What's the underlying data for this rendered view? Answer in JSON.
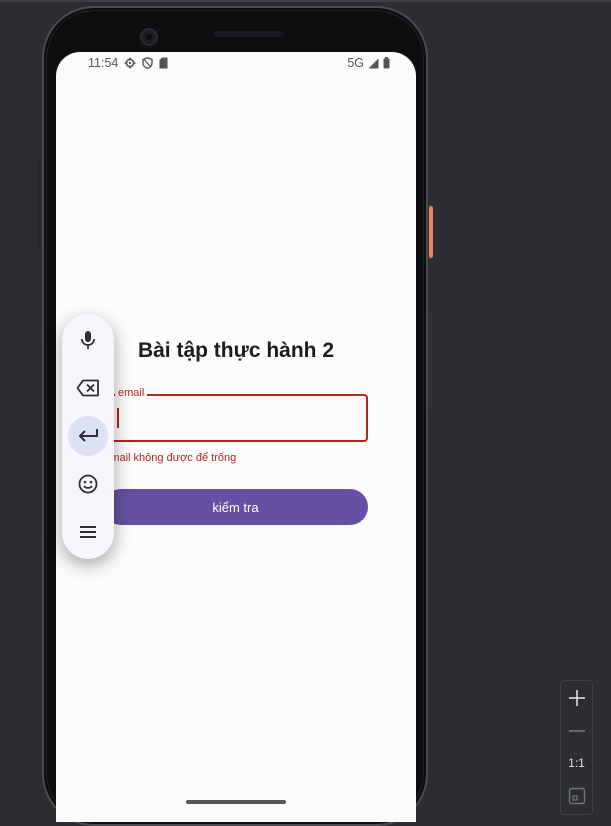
{
  "status_bar": {
    "time": "11:54",
    "network": "5G",
    "left_icons": [
      "gear-icon",
      "shield-icon",
      "sd-card-icon"
    ],
    "right_icons": [
      "signal-icon",
      "battery-icon"
    ]
  },
  "app": {
    "title": "Bài tập thực hành 2",
    "email_field": {
      "label": "email",
      "value": "",
      "error": "Email không được để trống"
    },
    "check_button": "kiểm tra"
  },
  "keyboard_toolbar": {
    "buttons": [
      {
        "icon": "microphone-icon",
        "active": false
      },
      {
        "icon": "backspace-icon",
        "active": false
      },
      {
        "icon": "enter-icon",
        "active": true
      },
      {
        "icon": "emoji-icon",
        "active": false
      },
      {
        "icon": "menu-icon",
        "active": false
      }
    ]
  },
  "emulator_zoom": {
    "zoom_in": "+",
    "zoom_out": "-",
    "actual_size_label": "1:1",
    "fit_label": "fit-to-screen"
  },
  "colors": {
    "primary": "#6750a4",
    "error": "#b3261e",
    "screen_bg": "#fcfcfc",
    "ide_bg": "#2b2d30",
    "power_button": "#e8836a"
  }
}
